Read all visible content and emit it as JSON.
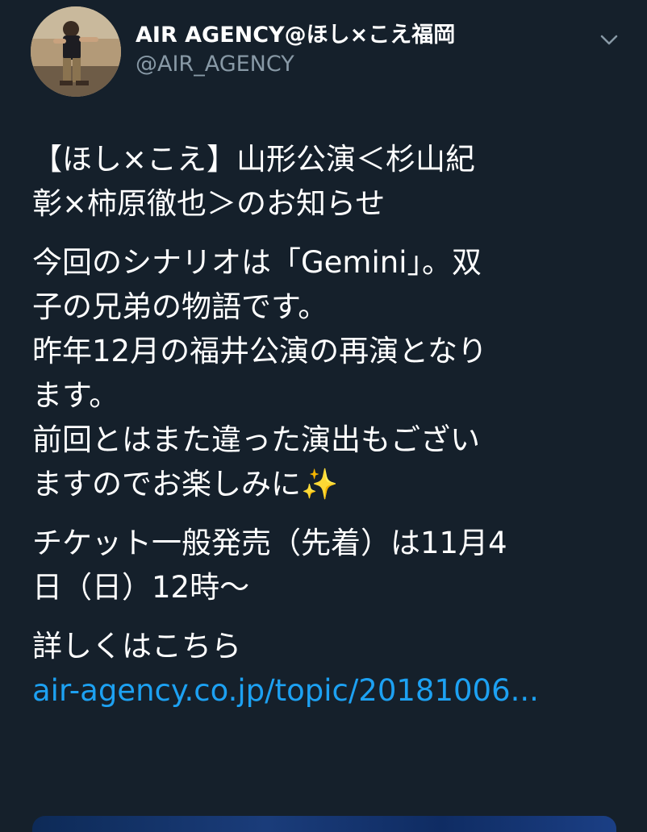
{
  "author": {
    "display_name": "AIR AGENCY@ほし×こえ福岡",
    "handle": "@AIR_AGENCY",
    "avatar_icon": "avatar-photo"
  },
  "menu": {
    "caret_icon": "chevron-down-icon"
  },
  "tweet": {
    "title_lines": [
      "【ほし×こえ】山形公演＜杉山紀",
      "彰×柿原徹也＞のお知らせ"
    ],
    "paragraph_2_lines": [
      "今回のシナリオは「Gemini」。双",
      "子の兄弟の物語です。",
      "昨年12月の福井公演の再演となり",
      "ます。",
      "前回とはまた違った演出もござい",
      "ますのでお楽しみに"
    ],
    "sparkle_emoji": "✨",
    "ticket_lines": [
      "チケット一般発売（先着）は11月4",
      "日（日）12時〜"
    ],
    "details_label": "詳しくはこちら",
    "link_text": "air-agency.co.jp/topic/20181006..."
  },
  "colors": {
    "background": "#15202b",
    "text": "#ffffff",
    "secondary_text": "#8899a6",
    "link": "#1da1f2"
  }
}
